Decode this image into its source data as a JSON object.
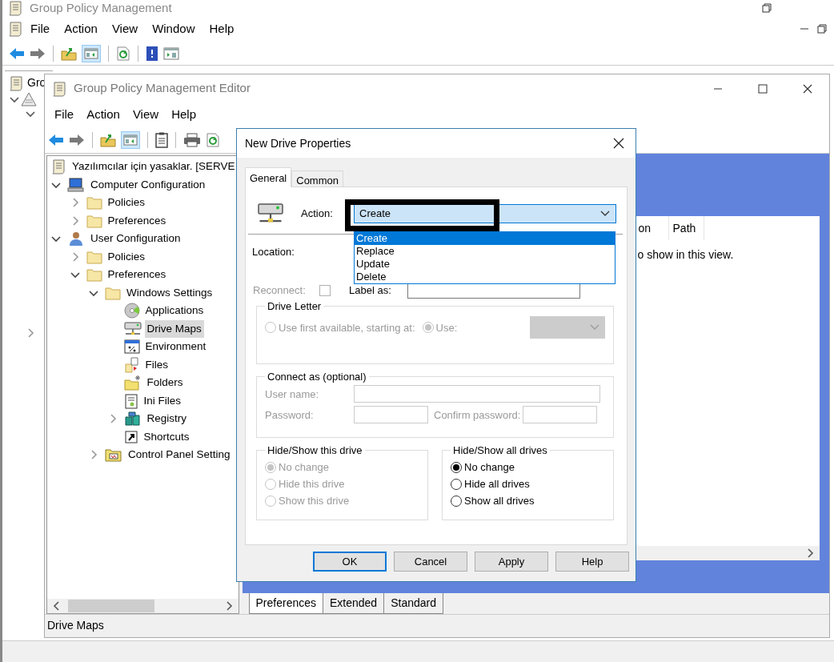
{
  "main_window": {
    "title": "Group Policy Management",
    "menu": [
      "File",
      "Action",
      "View",
      "Window",
      "Help"
    ],
    "tree_label": "Gro"
  },
  "editor": {
    "title": "Group Policy Management Editor",
    "menu": [
      "File",
      "Action",
      "View",
      "Help"
    ],
    "tree": [
      {
        "label": "Yazılımcılar için yasaklar. [SERVE",
        "kind": "gpo",
        "selected": false,
        "children": [
          {
            "label": "Computer Configuration",
            "kind": "computer",
            "expanded": true,
            "selected": false,
            "children": [
              {
                "label": "Policies",
                "kind": "folder",
                "expanded": false,
                "selected": false
              },
              {
                "label": "Preferences",
                "kind": "folder",
                "expanded": false,
                "selected": false
              }
            ]
          },
          {
            "label": "User Configuration",
            "kind": "user",
            "expanded": true,
            "selected": false,
            "children": [
              {
                "label": "Policies",
                "kind": "folder",
                "expanded": false,
                "selected": false
              },
              {
                "label": "Preferences",
                "kind": "folder",
                "expanded": true,
                "selected": false,
                "children": [
                  {
                    "label": "Windows Settings",
                    "kind": "folder",
                    "expanded": true,
                    "selected": false,
                    "children": [
                      {
                        "label": "Applications",
                        "kind": "disc",
                        "selected": false
                      },
                      {
                        "label": "Drive Maps",
                        "kind": "drive",
                        "selected": true
                      },
                      {
                        "label": "Environment",
                        "kind": "window",
                        "selected": false
                      },
                      {
                        "label": "Files",
                        "kind": "files",
                        "selected": false
                      },
                      {
                        "label": "Folders",
                        "kind": "newfolder",
                        "selected": false
                      },
                      {
                        "label": "Ini Files",
                        "kind": "notepad",
                        "selected": false
                      },
                      {
                        "label": "Registry",
                        "kind": "cubes",
                        "expanded": false,
                        "selected": false
                      },
                      {
                        "label": "Shortcuts",
                        "kind": "shortcut",
                        "selected": false
                      }
                    ]
                  },
                  {
                    "label": "Control Panel Setting",
                    "kind": "panelfolder",
                    "expanded": false,
                    "selected": false
                  }
                ]
              }
            ]
          }
        ]
      }
    ],
    "list": {
      "columns": [
        "on",
        "Path"
      ],
      "message": "o show in this view."
    },
    "bottom_tabs": [
      {
        "label": "Preferences",
        "selected": true
      },
      {
        "label": "Extended",
        "selected": false
      },
      {
        "label": "Standard",
        "selected": false
      }
    ],
    "status": "Drive Maps"
  },
  "dialog": {
    "title": "New Drive Properties",
    "tabs": [
      {
        "label": "General",
        "selected": true
      },
      {
        "label": "Common",
        "selected": false
      }
    ],
    "action": {
      "label": "Action:",
      "value": "Create",
      "options": [
        {
          "label": "Create",
          "selected": true
        },
        {
          "label": "Replace",
          "selected": false
        },
        {
          "label": "Update",
          "selected": false
        },
        {
          "label": "Delete",
          "selected": false
        }
      ]
    },
    "location": {
      "label": "Location:"
    },
    "reconnect": {
      "label": "Reconnect:",
      "checked": false,
      "disabled": true
    },
    "label_as": {
      "label": "Label as:"
    },
    "drive_letter": {
      "title": "Drive Letter",
      "disabled": true,
      "options": [
        {
          "label": "Use first available, starting at:",
          "selected": false
        },
        {
          "label": "Use:",
          "selected": true
        }
      ]
    },
    "connect_as": {
      "title": "Connect as (optional)",
      "disabled": true,
      "fields": [
        {
          "label": "User name:"
        },
        {
          "label": "Password:"
        },
        {
          "label": "Confirm password:"
        }
      ]
    },
    "hide_show": [
      {
        "title": "Hide/Show this drive",
        "disabled": true,
        "options": [
          {
            "label": "No change",
            "selected": true
          },
          {
            "label": "Hide this drive",
            "selected": false
          },
          {
            "label": "Show this drive",
            "selected": false
          }
        ]
      },
      {
        "title": "Hide/Show all drives",
        "disabled": false,
        "options": [
          {
            "label": "No change",
            "selected": true
          },
          {
            "label": "Hide all drives",
            "selected": false
          },
          {
            "label": "Show all drives",
            "selected": false
          }
        ]
      }
    ],
    "buttons": [
      {
        "label": "OK",
        "default": true
      },
      {
        "label": "Cancel",
        "default": false
      },
      {
        "label": "Apply",
        "default": false
      },
      {
        "label": "Help",
        "default": false
      }
    ]
  }
}
